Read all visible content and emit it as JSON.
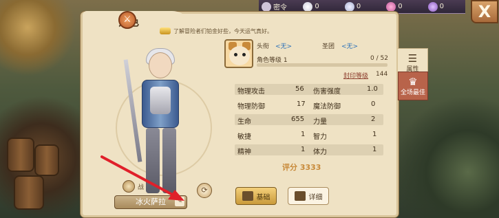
{
  "topbar": {
    "items": [
      {
        "icon": "chevron-down-icon",
        "label": "密令"
      },
      {
        "icon": "star-icon",
        "label": "0"
      },
      {
        "icon": "shell-icon",
        "label": "0"
      },
      {
        "icon": "gem-icon",
        "label": "0"
      },
      {
        "icon": "orb-icon",
        "label": "0"
      }
    ],
    "close_label": "X"
  },
  "panel": {
    "title": "角色",
    "notice": "了解冒险者们铂金好些，今天运气真好。",
    "portrait_icon": "cat-portrait-icon",
    "title_label": "头衔",
    "title_value": "<无>",
    "guild_label": "圣团",
    "guild_value": "<无>",
    "level_label": "角色等级 1",
    "exp_text": "0 / 52",
    "exp_fraction": 0,
    "seal_label": "封印等级",
    "seal_value": "144"
  },
  "stats": [
    {
      "a_label": "物理攻击",
      "a_value": "56",
      "b_label": "伤害强度",
      "b_value": "1.0"
    },
    {
      "a_label": "物理防御",
      "a_value": "17",
      "b_label": "魔法防御",
      "b_value": "0"
    },
    {
      "a_label": "生命",
      "a_value": "655",
      "b_label": "力量",
      "b_value": "2"
    },
    {
      "a_label": "敏捷",
      "a_value": "1",
      "b_label": "智力",
      "b_value": "1"
    },
    {
      "a_label": "精神",
      "a_value": "1",
      "b_label": "体力",
      "b_value": "1"
    }
  ],
  "score_text": "评分 3333",
  "buttons": {
    "basic": "基础",
    "detail": "详细"
  },
  "side_tabs": {
    "attr": "属性",
    "best": "全场最佳"
  },
  "character": {
    "name": "冰火萨拉",
    "guild_label": "战"
  }
}
